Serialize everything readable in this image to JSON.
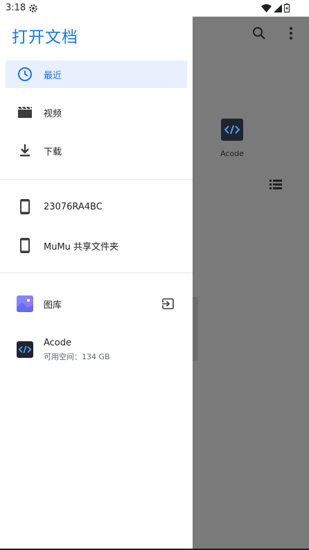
{
  "status_bar": {
    "time": "3:18",
    "icons": [
      "gear-icon",
      "wifi-icon",
      "signal-icon",
      "battery-icon"
    ]
  },
  "drawer": {
    "title": "打开文档",
    "recents_section": [
      {
        "label": "最近",
        "icon": "clock-icon",
        "selected": true
      },
      {
        "label": "视频",
        "icon": "movie-icon",
        "selected": false
      },
      {
        "label": "下载",
        "icon": "download-icon",
        "selected": false
      }
    ],
    "devices_section": [
      {
        "label": "23076RA4BC",
        "icon": "phone-icon"
      },
      {
        "label": "MuMu 共享文件夹",
        "icon": "phone-icon"
      }
    ],
    "apps_section": [
      {
        "label": "图库",
        "icon": "gallery-icon",
        "action_icon": "eject-icon"
      },
      {
        "label": "Acode",
        "subtitle": "可用空间：134 GB",
        "icon": "acode-icon"
      }
    ]
  },
  "background": {
    "toolbar_icons": [
      "search-icon",
      "more-vert-icon"
    ],
    "tile_label": "Acode",
    "view_toggle_icon": "list-view-icon"
  },
  "colors": {
    "accent": "#1a73e8",
    "selected_bg": "#e8f0fe",
    "scrim": "#7a7a7a",
    "acode_icon_bg": "#1f2430"
  }
}
